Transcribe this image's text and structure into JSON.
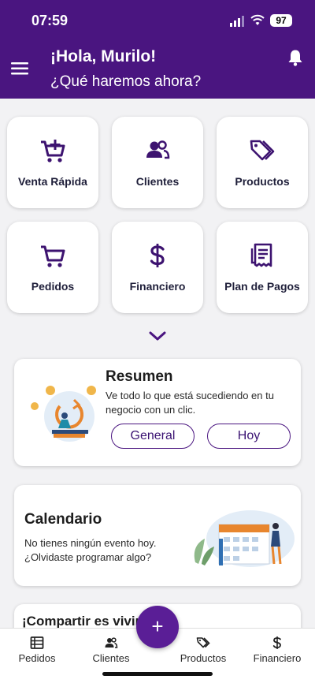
{
  "status_bar": {
    "time": "07:59",
    "battery": "97"
  },
  "header": {
    "greeting": "¡Hola, Murilo!",
    "subtitle": "¿Qué haremos ahora?"
  },
  "shortcuts": [
    {
      "label": "Venta Rápida",
      "icon": "cart-plus-icon"
    },
    {
      "label": "Clientes",
      "icon": "users-icon"
    },
    {
      "label": "Productos",
      "icon": "tags-icon"
    },
    {
      "label": "Pedidos",
      "icon": "cart-icon"
    },
    {
      "label": "Financiero",
      "icon": "dollar-icon"
    },
    {
      "label": "Plan de Pagos",
      "icon": "receipt-icon"
    }
  ],
  "summary": {
    "title": "Resumen",
    "text": "Ve todo lo que está sucediendo en tu negocio con un clic.",
    "general_label": "General",
    "today_label": "Hoy"
  },
  "calendar": {
    "title": "Calendario",
    "text": "No tienes ningún evento hoy. ¿Olvidaste programar algo?"
  },
  "share": {
    "title": "¡Compartir es vivir"
  },
  "tabbar": {
    "items": [
      {
        "label": "Pedidos",
        "icon": "list-icon"
      },
      {
        "label": "Clientes",
        "icon": "users-icon"
      },
      {
        "label": "Productos",
        "icon": "tags-icon"
      },
      {
        "label": "Financiero",
        "icon": "dollar-icon"
      }
    ],
    "fab_label": "+"
  },
  "colors": {
    "brand": "#4a1580",
    "accent": "#5a1e96",
    "background": "#f2f2f4"
  }
}
